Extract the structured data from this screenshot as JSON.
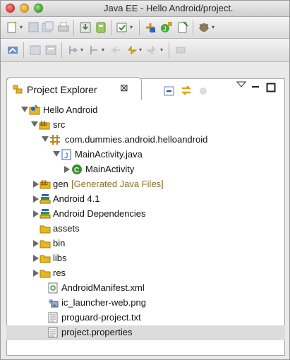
{
  "window": {
    "title": "Java EE - Hello Android/project."
  },
  "view": {
    "tab_label": "Project Explorer",
    "tab_close_glyph": "⊠"
  },
  "tree": [
    {
      "label": "Hello Android",
      "icon": "android-project-icon",
      "expanded": true
    },
    {
      "label": "src",
      "icon": "source-folder-icon",
      "expanded": true
    },
    {
      "label": "com.dummies.android.helloandroid",
      "icon": "package-icon",
      "expanded": true
    },
    {
      "label": "MainActivity.java",
      "icon": "java-file-icon",
      "expanded": true
    },
    {
      "label": "MainActivity",
      "icon": "class-icon",
      "expanded": false
    },
    {
      "label": "gen",
      "decoration": "[Generated Java Files]",
      "icon": "source-folder-icon",
      "expanded": false
    },
    {
      "label": "Android 4.1",
      "icon": "library-icon",
      "expanded": false
    },
    {
      "label": "Android Dependencies",
      "icon": "library-icon",
      "expanded": false
    },
    {
      "label": "assets",
      "icon": "folder-icon"
    },
    {
      "label": "bin",
      "icon": "folder-icon",
      "expanded": false
    },
    {
      "label": "libs",
      "icon": "folder-icon",
      "expanded": false
    },
    {
      "label": "res",
      "icon": "folder-icon",
      "expanded": false
    },
    {
      "label": "AndroidManifest.xml",
      "icon": "xml-file-icon"
    },
    {
      "label": "ic_launcher-web.png",
      "icon": "image-file-icon"
    },
    {
      "label": "proguard-project.txt",
      "icon": "text-file-icon"
    },
    {
      "label": "project.properties",
      "icon": "text-file-icon",
      "selected": true
    }
  ],
  "colors": {
    "selection": "#dcdcdc",
    "decoration": "#8a6d2a",
    "java_blue": "#2b62c9",
    "android_green": "#3a8f2e"
  }
}
